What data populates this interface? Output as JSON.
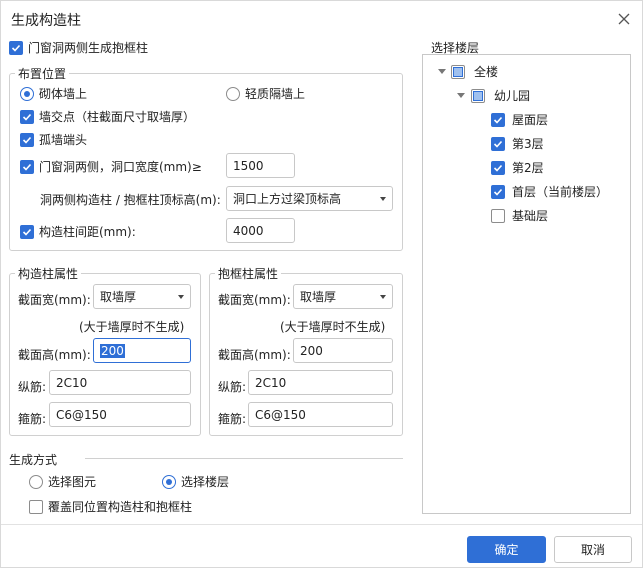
{
  "dialog": {
    "title": "生成构造柱"
  },
  "top_option": {
    "label": "门窗洞两侧生成抱框柱",
    "checked": true
  },
  "placement": {
    "legend": "布置位置",
    "radio_masonry": "砌体墙上",
    "radio_light": "轻质隔墙上",
    "wall_intersection": "墙交点（柱截面尺寸取墙厚）",
    "isolated_wall_end": "孤墙端头",
    "door_window_sides": "门窗洞两侧，洞口宽度(mm)≥",
    "door_window_width": "1500",
    "top_elevation_label": "洞两侧构造柱 / 抱框柱顶标高(m):",
    "top_elevation_value": "洞口上方过梁顶标高",
    "spacing_label": "构造柱间距(mm):",
    "spacing_value": "4000"
  },
  "column_props": {
    "legend": "构造柱属性",
    "width_label": "截面宽(mm):",
    "width_value": "取墙厚",
    "hint": "(大于墙厚时不生成)",
    "height_label": "截面高(mm):",
    "height_value": "200",
    "long_bar_label": "纵筋:",
    "long_bar_value": "2C10",
    "stirrup_label": "箍筋:",
    "stirrup_value": "C6@150"
  },
  "frame_props": {
    "legend": "抱框柱属性",
    "width_label": "截面宽(mm):",
    "width_value": "取墙厚",
    "hint": "(大于墙厚时不生成)",
    "height_label": "截面高(mm):",
    "height_value": "200",
    "long_bar_label": "纵筋:",
    "long_bar_value": "2C10",
    "stirrup_label": "箍筋:",
    "stirrup_value": "C6@150"
  },
  "generate": {
    "legend": "生成方式",
    "radio_select_element": "选择图元",
    "radio_select_floor": "选择楼层",
    "overwrite": "覆盖同位置构造柱和抱框柱"
  },
  "floors": {
    "legend": "选择楼层",
    "all": "全楼",
    "project": "幼儿园",
    "items": [
      {
        "label": "屋面层",
        "checked": true
      },
      {
        "label": "第3层",
        "checked": true
      },
      {
        "label": "第2层",
        "checked": true
      },
      {
        "label": "首层（当前楼层）",
        "checked": true
      },
      {
        "label": "基础层",
        "checked": false
      }
    ]
  },
  "buttons": {
    "ok": "确定",
    "cancel": "取消"
  },
  "colors": {
    "accent": "#2f6fd6",
    "border": "#c8c8c8"
  }
}
